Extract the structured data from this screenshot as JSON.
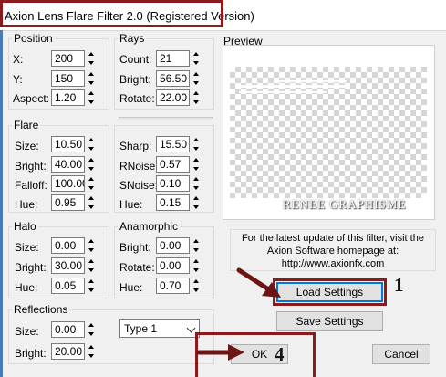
{
  "window": {
    "title": "Axion Lens Flare Filter 2.0 (Registered Version)"
  },
  "position": {
    "group_label": "Position",
    "x_label": "X:",
    "x_value": "200",
    "y_label": "Y:",
    "y_value": "150",
    "aspect_label": "Aspect:",
    "aspect_value": "1.20"
  },
  "rays": {
    "group_label": "Rays",
    "count_label": "Count:",
    "count_value": "21",
    "bright_label": "Bright:",
    "bright_value": "56.50",
    "rotate_label": "Rotate:",
    "rotate_value": "22.00"
  },
  "flare": {
    "group_label": "Flare",
    "size_label": "Size:",
    "size_value": "10.50",
    "bright_label": "Bright:",
    "bright_value": "40.00",
    "falloff_label": "Falloff:",
    "falloff_value": "100.00",
    "hue_label": "Hue:",
    "hue_value": "0.95"
  },
  "flare_right": {
    "sharp_label": "Sharp:",
    "sharp_value": "15.50",
    "rnoise_label": "RNoise:",
    "rnoise_value": "0.57",
    "snoise_label": "SNoise:",
    "snoise_value": "0.10",
    "hue_label": "Hue:",
    "hue_value": "0.15"
  },
  "halo": {
    "group_label": "Halo",
    "size_label": "Size:",
    "size_value": "0.00",
    "bright_label": "Bright:",
    "bright_value": "30.00",
    "hue_label": "Hue:",
    "hue_value": "0.05"
  },
  "anamorphic": {
    "group_label": "Anamorphic",
    "bright_label": "Bright:",
    "bright_value": "0.00",
    "rotate_label": "Rotate:",
    "rotate_value": "0.00",
    "hue_label": "Hue:",
    "hue_value": "0.70"
  },
  "reflections": {
    "group_label": "Reflections",
    "size_label": "Size:",
    "size_value": "0.00",
    "bright_label": "Bright:",
    "bright_value": "20.00",
    "type_selected": "Type 1"
  },
  "preview": {
    "label": "Preview",
    "watermark": "RENEE GRAPHISME"
  },
  "info": {
    "line1": "For the latest update of this filter, visit the",
    "line2": "Axion Software homepage at:",
    "line3": "http://www.axionfx.com"
  },
  "buttons": {
    "load_settings": "Load Settings",
    "save_settings": "Save Settings",
    "ok": "OK",
    "cancel": "Cancel"
  },
  "annotations": {
    "marker_load": "1",
    "marker_ok": "4",
    "highlight_color": "#8b1a1a"
  }
}
